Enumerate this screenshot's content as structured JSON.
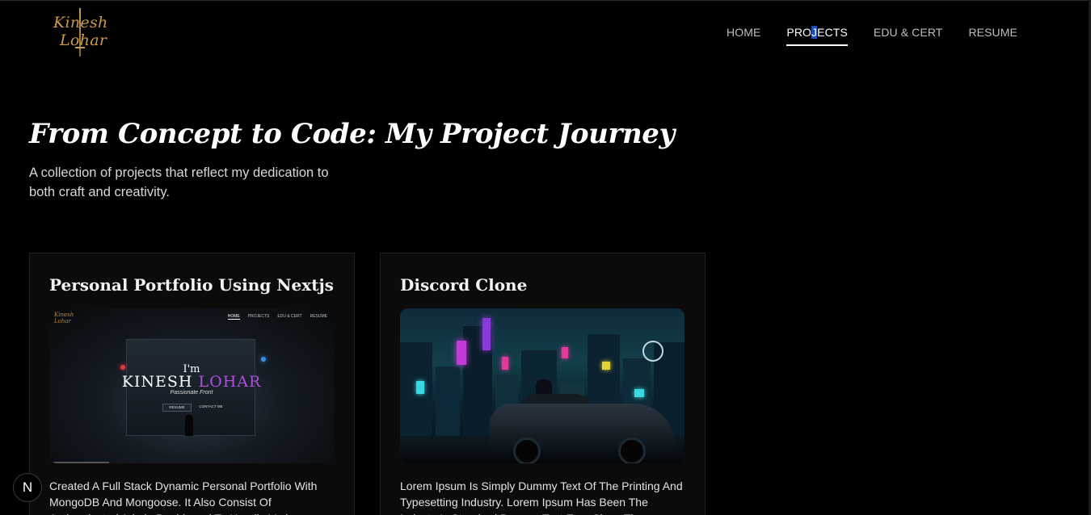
{
  "brand": {
    "logo_line1": "Kinesh",
    "logo_line2": "Lohar"
  },
  "nav": {
    "items": [
      {
        "label": "HOME"
      },
      {
        "label_pre": "PRO",
        "label_sel": "J",
        "label_post": "ECTS"
      },
      {
        "label": "EDU & CERT"
      },
      {
        "label": "RESUME"
      }
    ]
  },
  "hero": {
    "title": "From Concept to Code: My Project Journey",
    "subtitle": "A collection of projects that reflect my dedication to both craft and creativity."
  },
  "projects": [
    {
      "title": "Personal Portfolio Using Nextjs",
      "description": "Created A Full Stack Dynamic Personal Portfolio With MongoDB And Mongoose. It Also Consist Of Authenticated Admin Dashboard To Handle Various",
      "preview": {
        "mini_logo_1": "Kinesh",
        "mini_logo_2": "Lohar",
        "mini_nav": [
          "HOME",
          "PROJECTS",
          "EDU & CERT",
          "RESUME"
        ],
        "greeting": "I'm",
        "name_first": "KINESH",
        "name_last": "LOHAR",
        "tagline": "Passionate Front",
        "btn_resume": "RESUME",
        "btn_contact": "CONTACT ME"
      }
    },
    {
      "title": "Discord Clone",
      "description": "Lorem Ipsum Is Simply Dummy Text Of The Printing And Typesetting Industry. Lorem Ipsum Has Been The Industry's Standard Dummy Text Ever Since The"
    }
  ],
  "badge": {
    "letter": "N"
  },
  "colors": {
    "background": "#000000",
    "card": "#0b0b0b",
    "logo_gold": "#c99a4d",
    "accent_purple": "#b04ee0",
    "selection_blue": "#1f4fb3"
  }
}
